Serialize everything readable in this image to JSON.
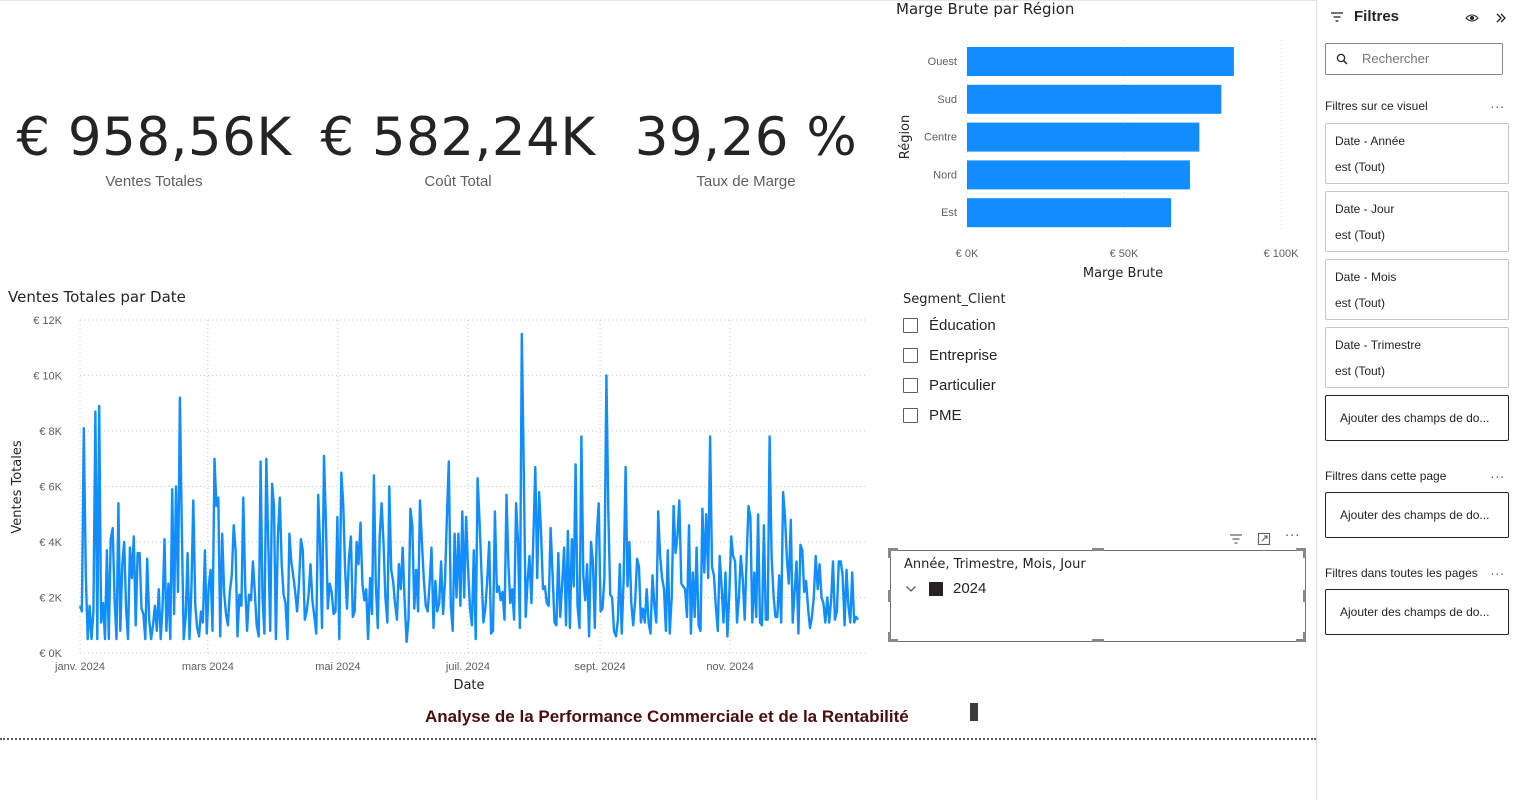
{
  "kpis": [
    {
      "value": "€ 958,56K",
      "label": "Ventes Totales"
    },
    {
      "value": "€ 582,24K",
      "label": "Coût Total"
    },
    {
      "value": "39,26 %",
      "label": "Taux de Marge"
    }
  ],
  "colors": {
    "bar": "#118dff",
    "line": "#118dff",
    "title_text": "#4b0d0d"
  },
  "bar_chart": {
    "title": "Marge Brute par Région",
    "y_title": "Région",
    "x_title": "Marge Brute",
    "x_ticks": [
      "€ 0K",
      "€ 50K",
      "€ 100K"
    ]
  },
  "line_chart": {
    "title": "Ventes Totales par Date",
    "x_title": "Date",
    "y_title": "Ventes Totales",
    "y_ticks": [
      "€ 0K",
      "€ 2K",
      "€ 4K",
      "€ 6K",
      "€ 8K",
      "€ 10K",
      "€ 12K"
    ],
    "x_ticks": [
      "janv. 2024",
      "mars 2024",
      "mai 2024",
      "juil. 2024",
      "sept. 2024",
      "nov. 2024"
    ]
  },
  "chart_data": [
    {
      "type": "bar",
      "orientation": "horizontal",
      "title": "Marge Brute par Région",
      "xlabel": "Marge Brute",
      "ylabel": "Région",
      "categories": [
        "Ouest",
        "Sud",
        "Centre",
        "Nord",
        "Est"
      ],
      "values": [
        85000,
        81000,
        74000,
        71000,
        65000
      ],
      "xlim": [
        0,
        100000
      ],
      "grid": true
    },
    {
      "type": "line",
      "title": "Ventes Totales par Date",
      "xlabel": "Date",
      "ylabel": "Ventes Totales",
      "ylim": [
        0,
        12000
      ],
      "x_start": "2024-01-01",
      "x_end": "2024-12-31",
      "grid": true,
      "series": [
        {
          "name": "",
          "values": [
            1700,
            1500,
            8100,
            2800,
            500,
            1700,
            500,
            1500,
            8700,
            500,
            8900,
            1100,
            1800,
            500,
            3700,
            500,
            4100,
            4500,
            1900,
            500,
            5400,
            800,
            3200,
            4000,
            1600,
            500,
            3800,
            2700,
            4200,
            1000,
            3600,
            3600,
            1600,
            1400,
            500,
            3400,
            1200,
            500,
            1000,
            1700,
            800,
            2300,
            500,
            1700,
            4100,
            800,
            2500,
            500,
            5900,
            1400,
            6000,
            2200,
            9200,
            4500,
            500,
            1300,
            3600,
            500,
            2300,
            5500,
            1700,
            900,
            600,
            1500,
            1100,
            3700,
            700,
            2400,
            3000,
            800,
            7000,
            5300,
            5600,
            600,
            4300,
            2200,
            1400,
            1000,
            2200,
            2800,
            4600,
            3700,
            600,
            2100,
            1700,
            5600,
            2400,
            800,
            2100,
            1900,
            3300,
            2200,
            1000,
            600,
            6900,
            2000,
            700,
            7000,
            3900,
            800,
            6100,
            5300,
            500,
            4200,
            5600,
            3200,
            2100,
            1800,
            500,
            4300,
            3300,
            2800,
            2200,
            1500,
            2500,
            4100,
            3700,
            1200,
            1500,
            2100,
            3200,
            1900,
            1300,
            700,
            5700,
            3900,
            900,
            7100,
            4700,
            1600,
            2500,
            2200,
            1400,
            1500,
            4900,
            500,
            6500,
            5400,
            3000,
            1600,
            3400,
            4200,
            1300,
            1500,
            4000,
            3200,
            4700,
            2500,
            1900,
            2300,
            500,
            2700,
            1400,
            6400,
            2500,
            900,
            4200,
            5400,
            4000,
            2000,
            1100,
            6000,
            3000,
            2600,
            1800,
            1200,
            3200,
            2300,
            3800,
            1900,
            400,
            1200,
            5200,
            4600,
            1600,
            3000,
            1500,
            5500,
            4000,
            2600,
            1700,
            1500,
            2500,
            3800,
            900,
            2600,
            1500,
            1800,
            3300,
            1400,
            2600,
            4900,
            6900,
            1700,
            800,
            4300,
            2000,
            4300,
            1700,
            5100,
            2000,
            4900,
            3100,
            1600,
            1000,
            3700,
            500,
            6300,
            4700,
            2900,
            1100,
            1600,
            2600,
            4000,
            700,
            800,
            5100,
            2200,
            2400,
            1900,
            2200,
            1200,
            5700,
            3200,
            1800,
            2300,
            1200,
            5400,
            4000,
            900,
            11500,
            6800,
            1300,
            2600,
            3500,
            1800,
            4200,
            6700,
            2700,
            5800,
            4400,
            2300,
            2400,
            1800,
            1700,
            4500,
            2800,
            1100,
            1000,
            3600,
            1300,
            2500,
            3800,
            1000,
            4400,
            900,
            4100,
            2400,
            6800,
            1700,
            900,
            7800,
            2800,
            1900,
            3200,
            600,
            4000,
            3300,
            900,
            4200,
            5400,
            1500,
            1600,
            2700,
            10000,
            5100,
            2100,
            2000,
            800,
            600,
            1200,
            3200,
            700,
            2600,
            6700,
            2400,
            4000,
            1800,
            1000,
            1900,
            3400,
            3100,
            1100,
            1600,
            1100,
            2300,
            1100,
            700,
            2800,
            1700,
            1100,
            5100,
            3500,
            2700,
            2300,
            800,
            3700,
            700,
            2000,
            5300,
            3600,
            4200,
            5500,
            2500,
            2400,
            2300,
            1300,
            4600,
            700,
            2900,
            1300,
            3800,
            1000,
            800,
            5200,
            2900,
            5000,
            2700,
            7800,
            3100,
            2800,
            1700,
            800,
            3500,
            2400,
            1100,
            2900,
            600,
            2100,
            4200,
            3500,
            3300,
            1100,
            2000,
            3500,
            2700,
            1200,
            3400,
            5300,
            4900,
            1100,
            2900,
            1300,
            5000,
            1100,
            1000,
            4600,
            1200,
            1200,
            7800,
            3500,
            2100,
            1300,
            1300,
            2800,
            1100,
            5800,
            4900,
            3400,
            2500,
            4800,
            1100,
            2200,
            3300,
            700,
            3900,
            3700,
            2200,
            2600,
            1600,
            900,
            1300,
            2000,
            3500,
            2300,
            3200,
            2000,
            1800,
            1100,
            2000,
            1100,
            1900,
            3300,
            1200,
            1500,
            3300,
            3300,
            2800,
            1000,
            3000,
            1700,
            1100,
            2900,
            1100,
            1300,
            1200
          ]
        }
      ]
    }
  ],
  "slicer": {
    "title": "Segment_Client",
    "items": [
      "Éducation",
      "Entreprise",
      "Particulier",
      "PME"
    ]
  },
  "hierarchy_slicer": {
    "title": "Année, Trimestre, Mois, Jour",
    "item": "2024"
  },
  "filters_pane": {
    "title": "Filtres",
    "search_placeholder": "Rechercher",
    "section_visual": "Filtres sur ce visuel",
    "section_page": "Filtres dans cette page",
    "section_all": "Filtres dans toutes les pages",
    "more": "...",
    "cards": [
      {
        "name": "Date - Année",
        "state": "est (Tout)"
      },
      {
        "name": "Date - Jour",
        "state": "est (Tout)"
      },
      {
        "name": "Date - Mois",
        "state": "est (Tout)"
      },
      {
        "name": "Date - Trimestre",
        "state": "est (Tout)"
      }
    ],
    "add_fields": "Ajouter des champs de do..."
  },
  "report_title": "Analyse de la Performance Commerciale et de la Rentabilité"
}
